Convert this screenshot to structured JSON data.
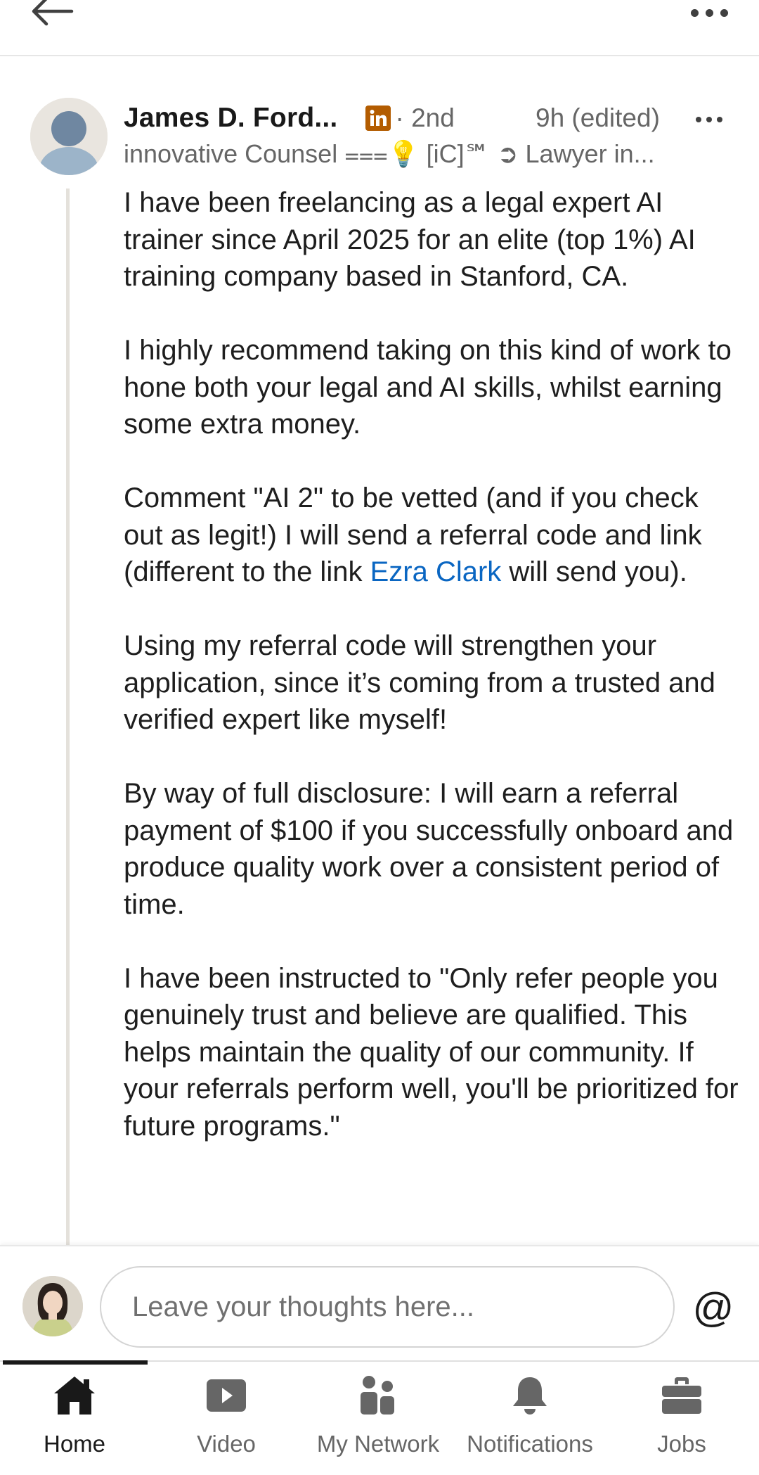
{
  "header": {
    "back_icon": "arrow-left-icon",
    "more_icon": "more-horizontal-icon"
  },
  "comment": {
    "author_name": "James D. Ford...",
    "badge_icon": "linkedin-icon",
    "badge_color": "#b35c00",
    "connection_degree": "· 2nd",
    "time": "9h (edited)",
    "headline": "innovative Counsel ⩶💡 [iC]℠ ➲ Lawyer in...",
    "paragraphs": {
      "p1": "I have been freelancing as a legal expert AI trainer since April 2025 for an elite (top 1%) AI training company based in Stanford, CA.",
      "p2": "I highly recommend taking on this kind of work to hone both your legal and AI skills, whilst earning some extra money.",
      "p3_before": "Comment \"AI 2\" to be vetted (and if you check out as legit!) I will send a referral code and link (different to the link ",
      "p3_mention": "Ezra Clark",
      "p3_after": " will send you).",
      "p4": "Using my referral code will strengthen your application, since it’s coming from a trusted and verified expert like myself!",
      "p5": "By way of full disclosure: I will earn a referral payment of $100 if you successfully onboard and produce quality work over a consistent period of time.",
      "p6": "I have been instructed to \"Only refer people you genuinely trust and believe are qualified. This helps maintain the quality of our community. If your referrals perform well, you'll be prioritized for future programs.\""
    }
  },
  "composer": {
    "placeholder": "Leave your thoughts here...",
    "at_label": "@"
  },
  "nav": {
    "home": "Home",
    "video": "Video",
    "network": "My Network",
    "notifications": "Notifications",
    "jobs": "Jobs"
  },
  "colors": {
    "accent_link": "#0a66c2",
    "text_primary": "#191919",
    "text_secondary": "#666666"
  }
}
